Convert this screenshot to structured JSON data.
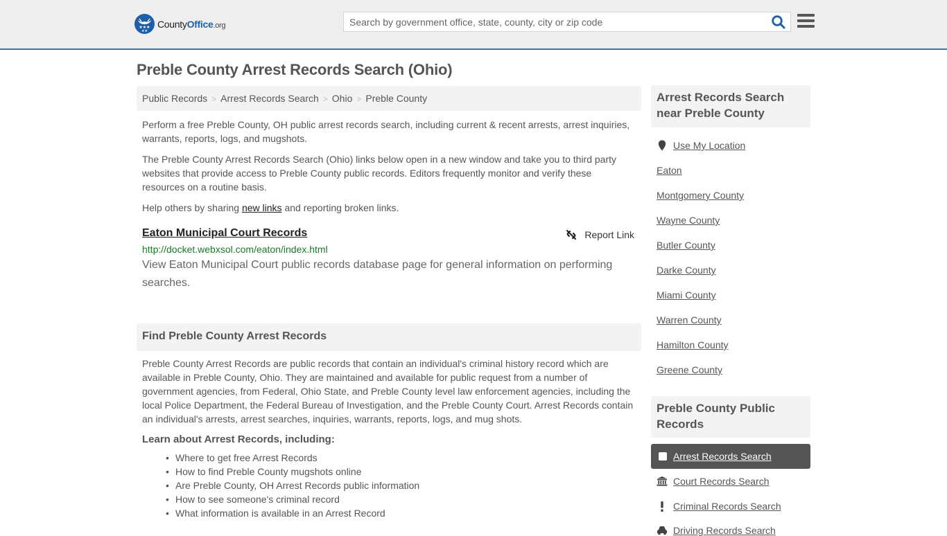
{
  "header": {
    "logo": {
      "county": "County",
      "office": "Office",
      "org": ".org"
    },
    "search_placeholder": "Search by government office, state, county, city or zip code",
    "search_icon": "search-icon",
    "menu_icon": "hamburger-menu-icon",
    "accent_color": "#2e7bb8"
  },
  "page": {
    "title": "Preble County Arrest Records Search (Ohio)"
  },
  "breadcrumb": [
    {
      "label": "Public Records"
    },
    {
      "label": "Arrest Records Search"
    },
    {
      "label": "Ohio"
    },
    {
      "label": "Preble County"
    }
  ],
  "intro": {
    "p1": "Perform a free Preble County, OH public arrest records search, including current & recent arrests, arrest inquiries, warrants, reports, logs, and mugshots.",
    "p2": "The Preble County Arrest Records Search (Ohio) links below open in a new window and take you to third party websites that provide access to Preble County public records. Editors frequently monitor and verify these resources on a routine basis.",
    "p3_before": "Help others by sharing ",
    "p3_link": "new links",
    "p3_after": " and reporting broken links."
  },
  "records": [
    {
      "title": "Eaton Municipal Court Records",
      "url": "http://docket.webxsol.com/eaton/index.html",
      "description": "View Eaton Municipal Court public records database page for general information on performing searches.",
      "report_label": "Report Link"
    }
  ],
  "find_section": {
    "heading": "Find Preble County Arrest Records",
    "body": "Preble County Arrest Records are public records that contain an individual's criminal history record which are available in Preble County, Ohio. They are maintained and available for public request from a number of government agencies, from Federal, Ohio State, and Preble County level law enforcement agencies, including the local Police Department, the Federal Bureau of Investigation, and the Preble County Court. Arrest Records contain an individual's arrests, arrest searches, inquiries, warrants, reports, logs, and mug shots.",
    "learn_heading": "Learn about Arrest Records, including:",
    "learn_items": [
      "Where to get free Arrest Records",
      "How to find Preble County mugshots online",
      "Are Preble County, OH Arrest Records public information",
      "How to see someone's criminal record",
      "What information is available in an Arrest Record"
    ]
  },
  "sidebar": {
    "near_heading": "Arrest Records Search near Preble County",
    "use_location": "Use My Location",
    "nearby": [
      "Eaton",
      "Montgomery County",
      "Wayne County",
      "Butler County",
      "Darke County",
      "Miami County",
      "Warren County",
      "Hamilton County",
      "Greene County"
    ],
    "public_heading": "Preble County Public Records",
    "public_links": [
      {
        "label": "Arrest Records Search",
        "icon": "square-icon",
        "active": true
      },
      {
        "label": "Court Records Search",
        "icon": "courthouse-icon",
        "active": false
      },
      {
        "label": "Criminal Records Search",
        "icon": "exclamation-icon",
        "active": false
      },
      {
        "label": "Driving Records Search",
        "icon": "car-icon",
        "active": false
      }
    ]
  }
}
